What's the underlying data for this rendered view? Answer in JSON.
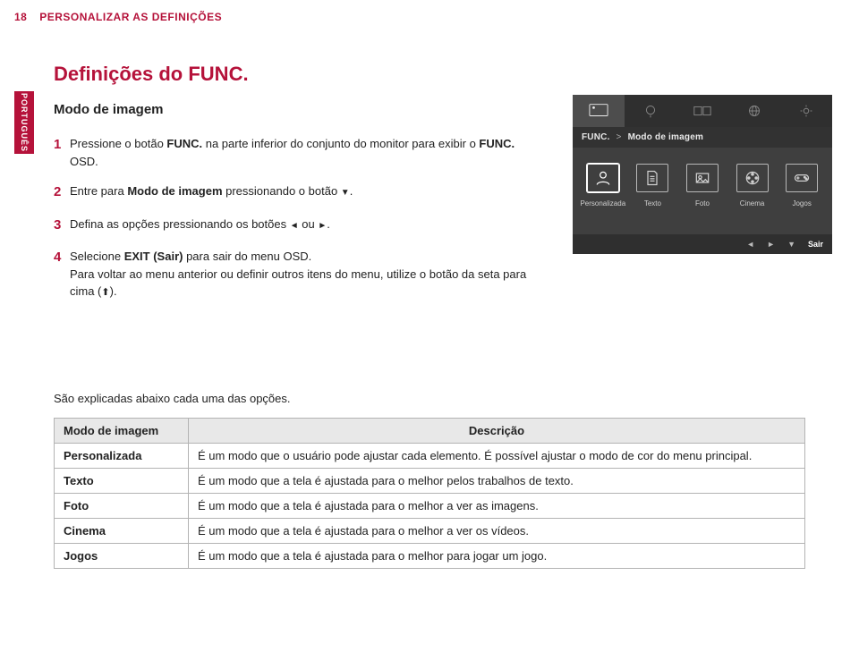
{
  "page_number": "18",
  "section_header": "PERSONALIZAR AS DEFINIÇÕES",
  "side_tab": "PORTUGUÊS",
  "title": "Definições do FUNC.",
  "subtitle": "Modo de imagem",
  "steps": {
    "n1": "1",
    "s1a": "Pressione o botão ",
    "s1b": "FUNC.",
    "s1c": " na parte inferior do conjunto do monitor para exibir o ",
    "s1d": "FUNC.",
    "s1e": " OSD.",
    "n2": "2",
    "s2a": "Entre para ",
    "s2b": "Modo de imagem",
    "s2c": "  pressionando o botão ",
    "n3": "3",
    "s3a": "Defina as opções pressionando os botões ",
    "s3b": " ou ",
    "s3c": ".",
    "n4": "4",
    "s4a": "Selecione ",
    "s4b": "EXIT (Sair)",
    "s4c": " para sair do menu OSD.",
    "s4d": "Para voltar ao menu anterior ou definir outros itens do menu, utilize o botão da seta para cima (",
    "s4e": ")."
  },
  "osd": {
    "path_a": "FUNC.",
    "sep": ">",
    "path_b": "Modo de imagem",
    "modes": {
      "m0": "Personalizada",
      "m1": "Texto",
      "m2": "Foto",
      "m3": "Cinema",
      "m4": "Jogos"
    },
    "nav_left": "◄",
    "nav_right": "►",
    "nav_down": "▼",
    "exit": "Sair"
  },
  "explanation_lead": "São explicadas abaixo cada uma das opções.",
  "table": {
    "h1": "Modo de imagem",
    "h2": "Descrição",
    "r1k": "Personalizada",
    "r1v": "É um modo que o usuário pode ajustar cada elemento. É possível ajustar o modo de cor do menu principal.",
    "r2k": "Texto",
    "r2v": "É um modo que a tela é ajustada para o melhor pelos trabalhos de texto.",
    "r3k": "Foto",
    "r3v": "É um modo que a tela é ajustada para o melhor a ver as imagens.",
    "r4k": "Cinema",
    "r4v": "É um modo que a tela é ajustada para o melhor a ver os vídeos.",
    "r5k": "Jogos",
    "r5v": " É um modo que a tela é ajustada para o melhor para jogar um jogo."
  }
}
